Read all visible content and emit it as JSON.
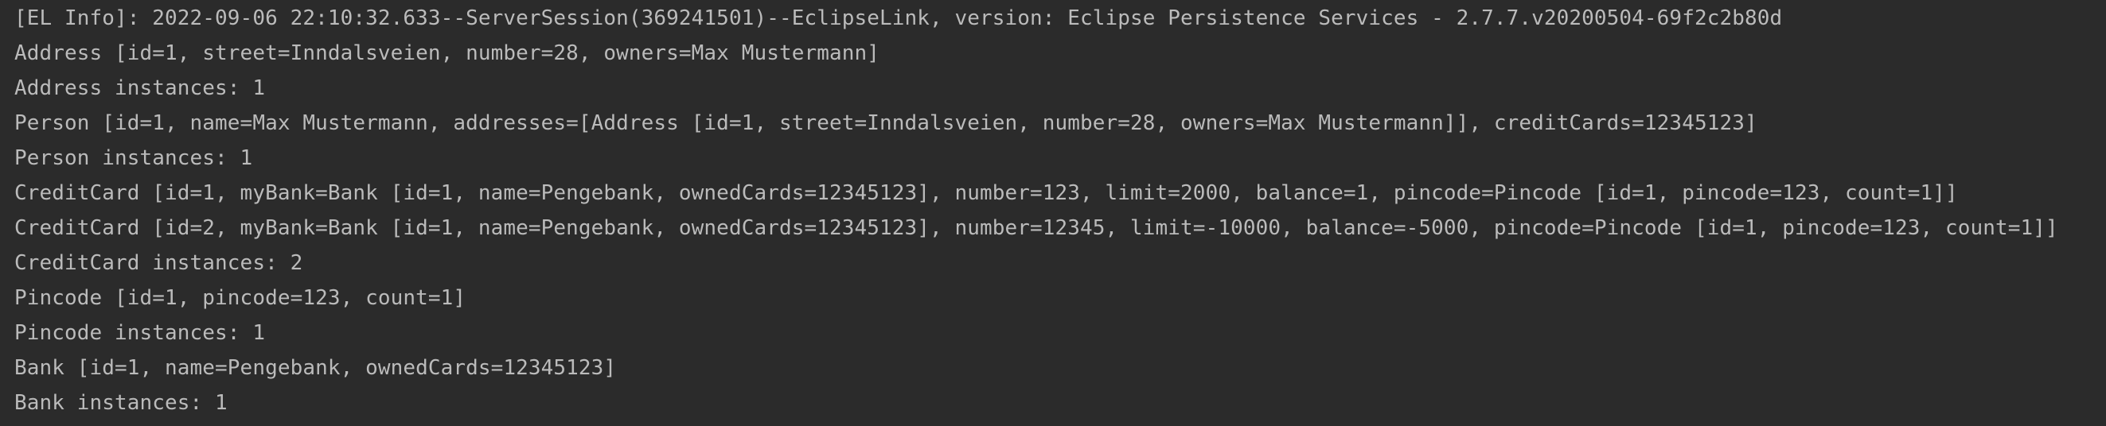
{
  "console": {
    "lines": [
      "[EL Info]: 2022-09-06 22:10:32.633--ServerSession(369241501)--EclipseLink, version: Eclipse Persistence Services - 2.7.7.v20200504-69f2c2b80d",
      "Address [id=1, street=Inndalsveien, number=28, owners=Max Mustermann]",
      "Address instances: 1",
      "Person [id=1, name=Max Mustermann, addresses=[Address [id=1, street=Inndalsveien, number=28, owners=Max Mustermann]], creditCards=12345123]",
      "Person instances: 1",
      "CreditCard [id=1, myBank=Bank [id=1, name=Pengebank, ownedCards=12345123], number=123, limit=2000, balance=1, pincode=Pincode [id=1, pincode=123, count=1]]",
      "CreditCard [id=2, myBank=Bank [id=1, name=Pengebank, ownedCards=12345123], number=12345, limit=-10000, balance=-5000, pincode=Pincode [id=1, pincode=123, count=1]]",
      "CreditCard instances: 2",
      "Pincode [id=1, pincode=123, count=1]",
      "Pincode instances: 1",
      "Bank [id=1, name=Pengebank, ownedCards=12345123]",
      "Bank instances: 1"
    ]
  }
}
